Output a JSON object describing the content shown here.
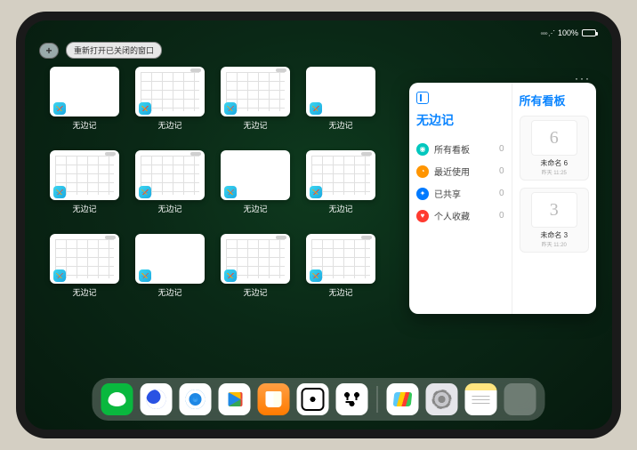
{
  "status": {
    "wifi": "▲",
    "battery": "100%"
  },
  "topbar": {
    "plus": "+",
    "reopen": "重新打开已关闭的窗口"
  },
  "app": {
    "name": "无边记"
  },
  "windows": [
    {
      "type": "blank"
    },
    {
      "type": "cal"
    },
    {
      "type": "cal"
    },
    {
      "type": "blank"
    },
    {
      "type": "cal"
    },
    {
      "type": "cal"
    },
    {
      "type": "blank"
    },
    {
      "type": "cal"
    },
    {
      "type": "cal"
    },
    {
      "type": "blank"
    },
    {
      "type": "cal"
    },
    {
      "type": "cal"
    }
  ],
  "panel": {
    "dots": "···",
    "title": "无边记",
    "right_title": "所有看板",
    "items": [
      {
        "icon": "teal",
        "glyph": "◉",
        "label": "所有看板",
        "count": "0"
      },
      {
        "icon": "orange",
        "glyph": "◔",
        "label": "最近使用",
        "count": "0"
      },
      {
        "icon": "blue",
        "glyph": "✦",
        "label": "已共享",
        "count": "0"
      },
      {
        "icon": "red",
        "glyph": "♥",
        "label": "个人收藏",
        "count": "0"
      }
    ],
    "boards": [
      {
        "sketch": "6",
        "name": "未命名 6",
        "date": "昨天 11:25"
      },
      {
        "sketch": "3",
        "name": "未命名 3",
        "date": "昨天 11:20"
      }
    ]
  },
  "dock": {
    "apps": [
      {
        "id": "wechat"
      },
      {
        "id": "qqblue"
      },
      {
        "id": "browser"
      },
      {
        "id": "play"
      },
      {
        "id": "books"
      },
      {
        "id": "dice"
      },
      {
        "id": "dots"
      }
    ],
    "recent": [
      {
        "id": "freeform"
      },
      {
        "id": "settings"
      },
      {
        "id": "notes"
      },
      {
        "id": "folder"
      }
    ]
  }
}
